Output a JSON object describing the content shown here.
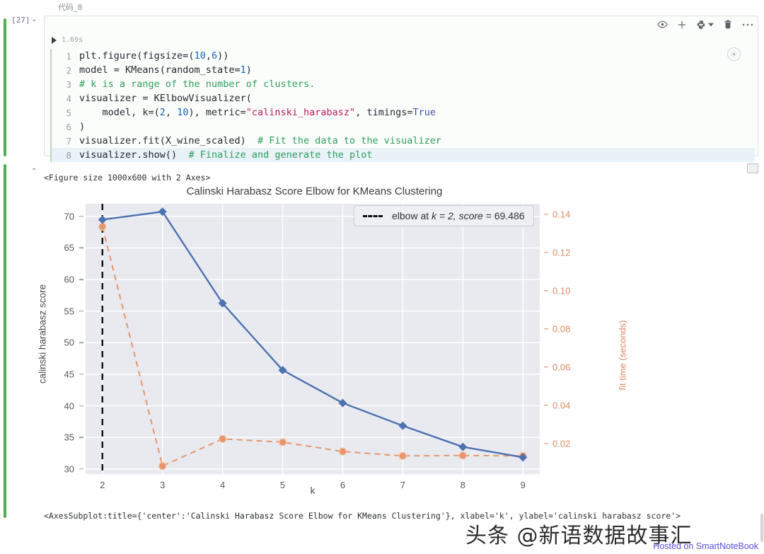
{
  "notebook": {
    "cell_label": "代码_8",
    "exec_count": "[27]",
    "caret": "⌄",
    "run_time": "1.69s",
    "toolbar": {
      "preview_icon": "eye-icon",
      "add_icon": "plus-icon",
      "kernel_icon": "python-kernel-icon",
      "dropdown_icon": "chevron-down-icon",
      "delete_icon": "trash-icon",
      "more_icon": "ellipsis-icon"
    },
    "code_lines": [
      {
        "n": "1",
        "tokens": [
          {
            "t": "plt.figure(figsize=(",
            "c": "plain"
          },
          {
            "t": "10",
            "c": "num"
          },
          {
            "t": ",",
            "c": "plain"
          },
          {
            "t": "6",
            "c": "num"
          },
          {
            "t": "))",
            "c": "plain"
          }
        ]
      },
      {
        "n": "2",
        "tokens": [
          {
            "t": "model = KMeans(random_state=",
            "c": "plain"
          },
          {
            "t": "1",
            "c": "num"
          },
          {
            "t": ")",
            "c": "plain"
          }
        ]
      },
      {
        "n": "3",
        "tokens": [
          {
            "t": "# k is a range of the number of clusters.",
            "c": "cmt"
          }
        ]
      },
      {
        "n": "4",
        "tokens": [
          {
            "t": "visualizer = KElbowVisualizer(",
            "c": "plain"
          }
        ]
      },
      {
        "n": "5",
        "tokens": [
          {
            "t": "    model, k=(",
            "c": "plain"
          },
          {
            "t": "2",
            "c": "num"
          },
          {
            "t": ", ",
            "c": "plain"
          },
          {
            "t": "10",
            "c": "num"
          },
          {
            "t": "), metric=",
            "c": "plain"
          },
          {
            "t": "\"calinski_harabasz\"",
            "c": "str"
          },
          {
            "t": ", timings=",
            "c": "plain"
          },
          {
            "t": "True",
            "c": "kw"
          }
        ]
      },
      {
        "n": "6",
        "tokens": [
          {
            "t": ")",
            "c": "plain"
          }
        ]
      },
      {
        "n": "7",
        "tokens": [
          {
            "t": "visualizer.fit(X_wine_scaled)  ",
            "c": "plain"
          },
          {
            "t": "# Fit the data to the visualizer",
            "c": "cmt"
          }
        ]
      },
      {
        "n": "8",
        "highlight": true,
        "tokens": [
          {
            "t": "visualizer.show()  ",
            "c": "plain"
          },
          {
            "t": "# Finalize and generate the plot",
            "c": "cmt"
          }
        ]
      }
    ],
    "output_repr_top": "<Figure size 1000x600 with 2 Axes>",
    "output_repr_bottom": "<AxesSubplot:title={'center':'Calinski Harabasz Score Elbow for KMeans Clustering'}, xlabel='k', ylabel='calinski harabasz score'>",
    "watermark": "头条 @新语数据故事汇",
    "hosted": "Hosted on SmartNoteBook"
  },
  "chart_data": {
    "type": "line",
    "title": "Calinski Harabasz Score Elbow for KMeans Clustering",
    "xlabel": "k",
    "ylabel": "calinski harabasz score",
    "y2label": "fit time (seconds)",
    "x": [
      2,
      3,
      4,
      5,
      6,
      7,
      8,
      9
    ],
    "xticks": [
      "2",
      "3",
      "4",
      "5",
      "6",
      "7",
      "8",
      "9"
    ],
    "xlim": [
      1.72,
      9.28
    ],
    "ylim": [
      29.2,
      72.0
    ],
    "yticks": [
      "30",
      "35",
      "40",
      "45",
      "50",
      "55",
      "60",
      "65",
      "70"
    ],
    "ytickvals": [
      30,
      35,
      40,
      45,
      50,
      55,
      60,
      65,
      70
    ],
    "y2lim": [
      0.004,
      0.1455
    ],
    "y2ticks": [
      "0.02",
      "0.04",
      "0.06",
      "0.08",
      "0.10",
      "0.12",
      "0.14"
    ],
    "y2tickvals": [
      0.02,
      0.04,
      0.06,
      0.08,
      0.1,
      0.12,
      0.14
    ],
    "grid": true,
    "legend_position": "upper right",
    "series": [
      {
        "name": "calinski harabasz score",
        "axis": "left",
        "color": "#4c72b0",
        "style": "solid",
        "marker": "diamond",
        "values": [
          69.486,
          70.75,
          56.25,
          45.65,
          40.45,
          36.85,
          33.5,
          31.85
        ]
      },
      {
        "name": "fit time (seconds)",
        "axis": "right",
        "color": "#e8956b",
        "style": "dashed",
        "marker": "circle",
        "values": [
          0.1335,
          0.0082,
          0.0224,
          0.0207,
          0.0158,
          0.0135,
          0.0137,
          0.0135
        ]
      }
    ],
    "annotations": [
      {
        "type": "vline",
        "x": 2,
        "color": "#111111",
        "style": "dashed"
      }
    ],
    "legend": [
      {
        "label": "elbow at k = 2, score = 69.486",
        "symbol": "dashed-line",
        "color": "#111111"
      }
    ],
    "legend_text_prefix": "elbow at ",
    "legend_k": "k = 2, ",
    "legend_score_word": "score",
    "legend_score_val": " = 69.486"
  },
  "colors": {
    "accent_blue": "#4c72b0",
    "accent_orange": "#dd8a62",
    "plot_bg": "#e8eaf0",
    "run_bar": "#4caf50"
  }
}
